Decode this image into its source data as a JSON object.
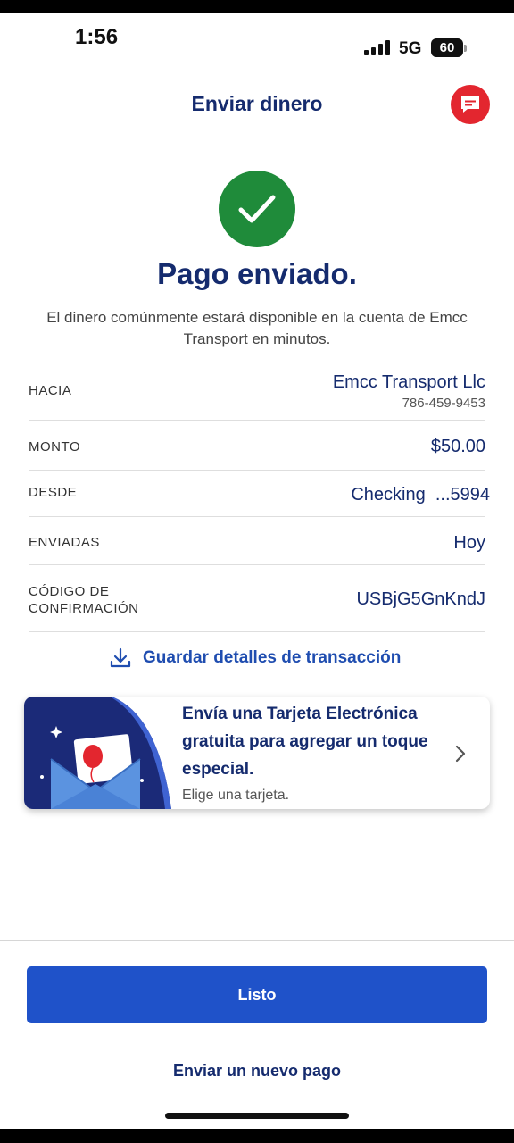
{
  "status_bar": {
    "time": "1:56",
    "network": "5G",
    "battery": "60"
  },
  "header": {
    "title": "Enviar dinero",
    "chat_icon": "chat-icon",
    "accent_color": "#e3262f"
  },
  "confirmation": {
    "icon": "checkmark-icon",
    "icon_color": "#1f8b3a",
    "title": "Pago enviado.",
    "message": "El dinero comúnmente estará disponible en la cuenta de Emcc Transport en minutos."
  },
  "details": {
    "to_label": "HACIA",
    "to_name": "Emcc Transport Llc",
    "to_phone": "786-459-9453",
    "amount_label": "MONTO",
    "amount_value": "$50.00",
    "from_label": "DESDE",
    "from_value": "Checking  ...5994",
    "sent_label": "ENVIADAS",
    "sent_value": "Hoy",
    "code_label_line1": "CÓDIGO DE",
    "code_label_line2": "CONFIRMACIÓN",
    "code_value": "USBjG5GnKndJ"
  },
  "save_details": {
    "label": "Guardar detalles de transacción",
    "icon": "download-icon"
  },
  "ecard": {
    "title": "Envía una Tarjeta Electrónica gratuita para agregar un toque especial.",
    "subtitle": "Elige una tarjeta.",
    "icon": "envelope-balloon-icon"
  },
  "actions": {
    "done_label": "Listo",
    "new_payment_label": "Enviar un nuevo pago",
    "primary_color": "#1f52c9"
  }
}
